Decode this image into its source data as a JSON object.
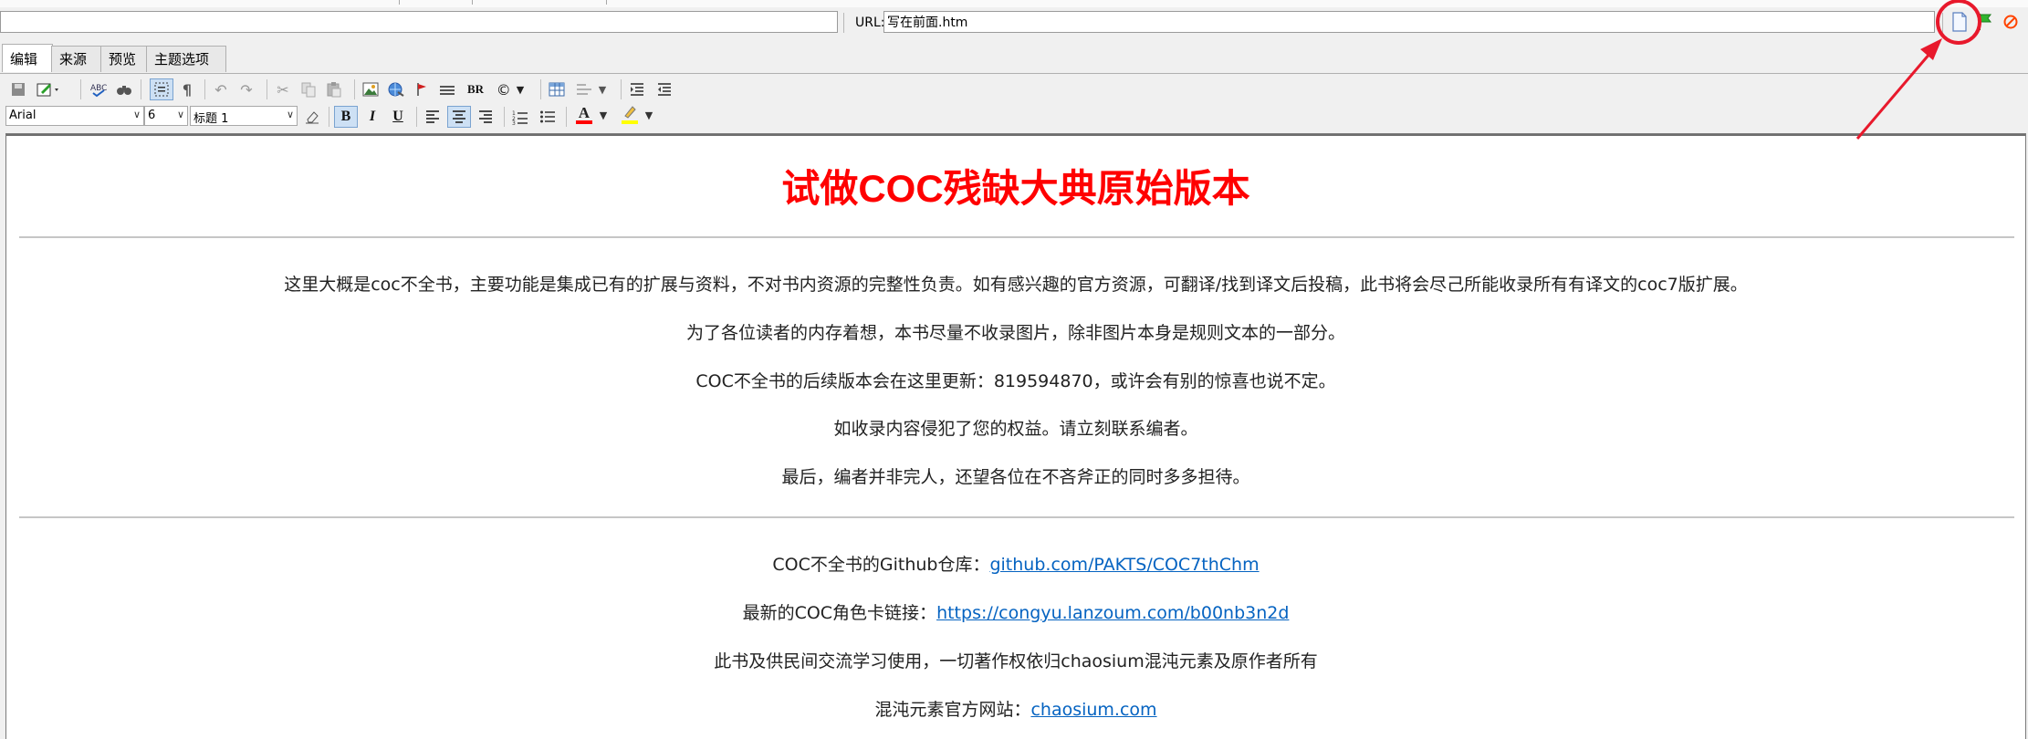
{
  "address_bar": {
    "title_value": "",
    "url_label": "URL:",
    "url_value": "写在前面.htm"
  },
  "tabs": [
    {
      "label": "编辑",
      "active": true
    },
    {
      "label": "来源",
      "active": false
    },
    {
      "label": "预览",
      "active": false
    },
    {
      "label": "主题选项",
      "active": false
    }
  ],
  "format_bar": {
    "font_family": "Arial",
    "font_size": "6",
    "paragraph_style": "标题 1",
    "br_label": "BR",
    "bold_label": "B",
    "italic_label": "I",
    "underline_label": "U",
    "font_color_label": "A"
  },
  "colors": {
    "title_red": "#ff0000",
    "link_blue": "#0563c1",
    "annotation_red": "#e8192c",
    "font_color_swatch": "#ff0000",
    "highlight_swatch": "#ffff00"
  },
  "icons": [
    "save-icon",
    "edit-icon",
    "spellcheck-icon",
    "find-icon",
    "select-all-icon",
    "pilcrow-icon",
    "undo-icon",
    "redo-icon",
    "cut-icon",
    "copy-icon",
    "paste-icon",
    "image-icon",
    "globe-icon",
    "bookmark-icon",
    "horizontal-rule-icon",
    "copyright-icon",
    "table-icon",
    "indent-icon",
    "outdent-icon",
    "new-page-icon",
    "green-flag-icon",
    "cancel-icon",
    "eraser-icon",
    "align-left-icon",
    "align-center-icon",
    "align-right-icon",
    "numbered-list-icon",
    "bulleted-list-icon",
    "highlight-icon"
  ],
  "document": {
    "title": "试做COC残缺大典原始版本",
    "paragraphs": [
      "这里大概是coc不全书，主要功能是集成已有的扩展与资料，不对书内资源的完整性负责。如有感兴趣的官方资源，可翻译/找到译文后投稿，此书将会尽己所能收录所有有译文的coc7版扩展。",
      "为了各位读者的内存着想，本书尽量不收录图片，除非图片本身是规则文本的一部分。",
      "COC不全书的后续版本会在这里更新：819594870，或许会有别的惊喜也说不定。",
      "如收录内容侵犯了您的权益。请立刻联系编者。",
      "最后，编者并非完人，还望各位在不吝斧正的同时多多担待。"
    ],
    "link_paragraphs": [
      {
        "prefix": "COC不全书的Github仓库：",
        "link": "github.com/PAKTS/COC7thChm"
      },
      {
        "prefix": "最新的COC角色卡链接：",
        "link": "https://congyu.lanzoum.com/b00nb3n2d"
      },
      {
        "prefix": "此书及供民间交流学习使用，一切著作权依归chaosium混沌元素及原作者所有",
        "link": ""
      },
      {
        "prefix": "混沌元素官方网站：",
        "link": "chaosium.com"
      }
    ]
  }
}
